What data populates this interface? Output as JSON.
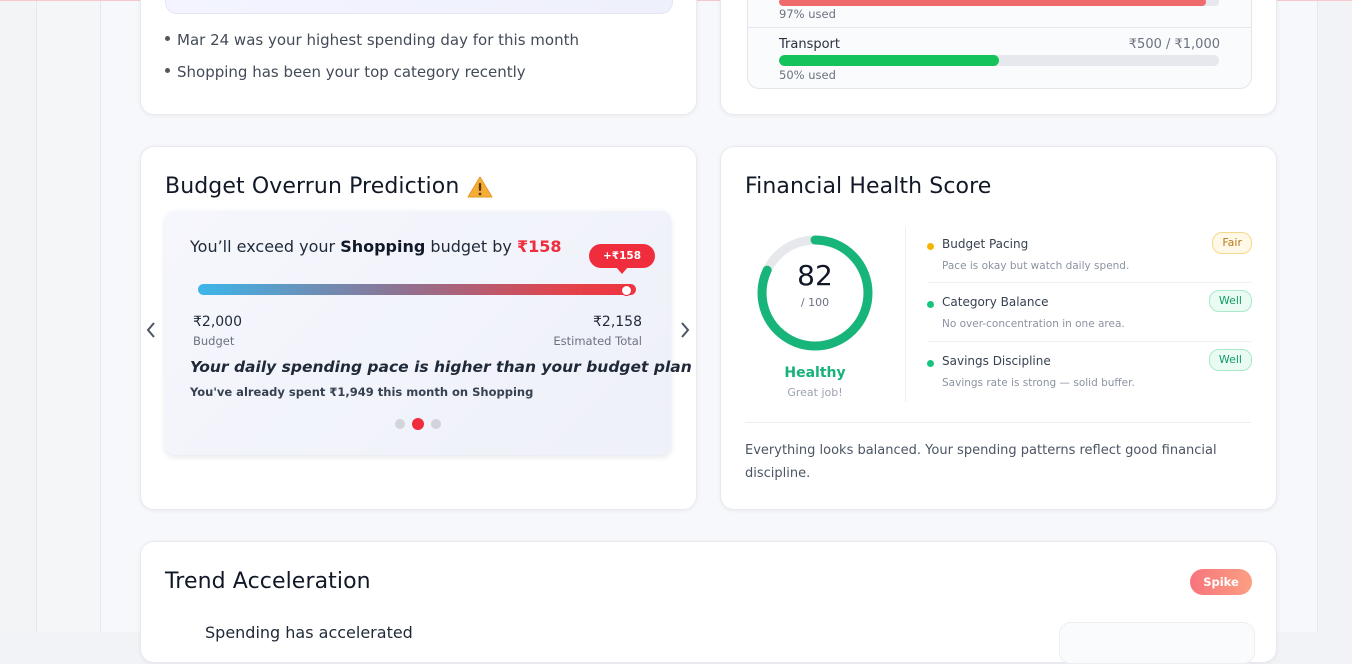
{
  "insights": {
    "items": [
      "Mar 24 was your highest spending day for this month",
      "Shopping has been your top category recently"
    ]
  },
  "budgets": {
    "top_row_used": "97% used",
    "top_row_progress": 0.97,
    "transport": {
      "name": "Transport",
      "amount": "₹500 / ₹1,000",
      "used": "50% used",
      "progress": 0.5
    }
  },
  "prediction": {
    "title": "Budget Overrun Prediction",
    "headline_prefix": "You’ll exceed your ",
    "headline_category": "Shopping",
    "headline_mid": " budget by ",
    "headline_amount": "₹158",
    "pill": "+₹158",
    "budget_value": "₹2,000",
    "budget_label": "Budget",
    "estimated_value": "₹2,158",
    "estimated_label": "Estimated Total",
    "pace": "Your daily spending pace is higher than your budget plan",
    "pace_sub": "You've already spent ₹1,949 this month on Shopping",
    "slides": 3,
    "active_slide": 2
  },
  "health": {
    "title": "Financial Health Score",
    "score": "82",
    "score_max": "/ 100",
    "score_fraction": 0.82,
    "status": "Healthy",
    "caption": "Great job!",
    "factors": [
      {
        "name": "Budget Pacing",
        "desc": "Pace is okay but watch daily spend.",
        "badge": "Fair",
        "color": "#f4b400"
      },
      {
        "name": "Category Balance",
        "desc": "No over-concentration in one area.",
        "badge": "Well",
        "color": "#16c47f"
      },
      {
        "name": "Savings Discipline",
        "desc": "Savings rate is strong — solid buffer.",
        "badge": "Well",
        "color": "#16c47f"
      }
    ],
    "summary": "Everything looks balanced. Your spending patterns reflect good financial discipline."
  },
  "trend": {
    "title": "Trend Acceleration",
    "badge": "Spike",
    "subtitle": "Spending has accelerated"
  },
  "colors": {
    "accent_red": "#ef2d3c",
    "success_green": "#16b27a",
    "transport_bar": "#14c35a"
  }
}
